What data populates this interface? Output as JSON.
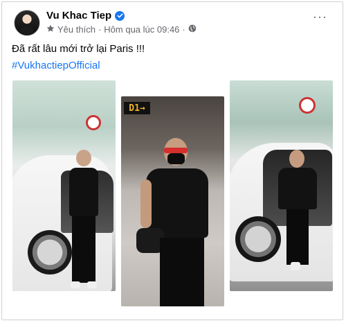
{
  "post": {
    "author": "Vu Khac Tiep",
    "meta_prefix": "Yêu thích",
    "separator": "·",
    "timestamp": "Hôm qua lúc 09:46",
    "caption": "Đã rất lâu mới trở lại Paris !!!",
    "hashtag": "#VukhactiepOfficial",
    "more_label": "···"
  },
  "photos": {
    "photo2_gate_sign": "D1→"
  },
  "colors": {
    "link": "#1877f2",
    "secondary_text": "#65676b",
    "primary_text": "#050505"
  },
  "icons": [
    "verified-badge-icon",
    "star-icon",
    "globe-icon",
    "more-options-icon"
  ]
}
